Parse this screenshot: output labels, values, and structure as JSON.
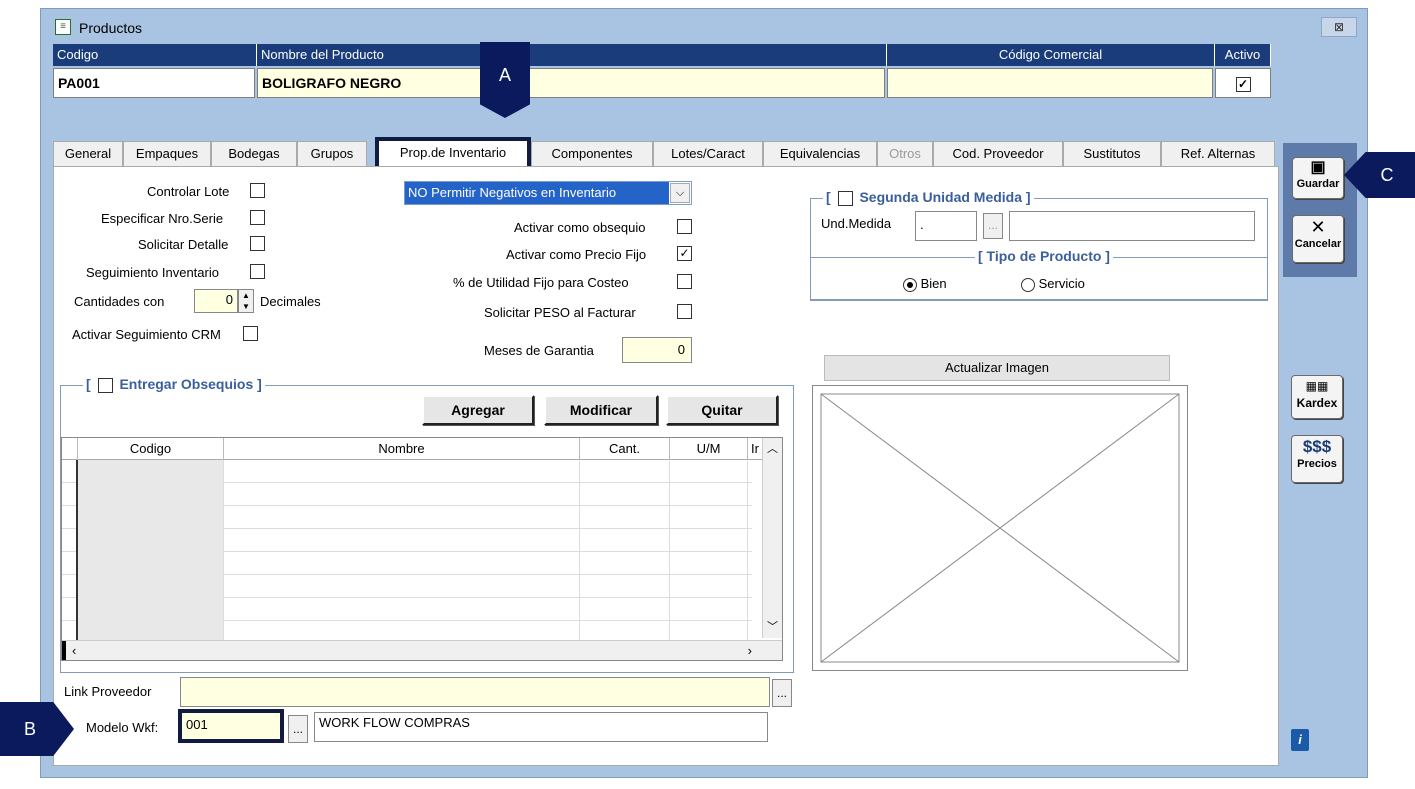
{
  "window": {
    "title": "Productos",
    "close": "⊠"
  },
  "header": {
    "cols": [
      "Codigo",
      "Nombre del Producto",
      "Código Comercial",
      "Activo"
    ],
    "codigo": "PA001",
    "nombre": "BOLIGRAFO NEGRO",
    "codigo_comercial": "",
    "activo_checked": "✓"
  },
  "tabs": [
    "General",
    "Empaques",
    "Bodegas",
    "Grupos",
    "Prop.de Inventario",
    "Componentes",
    "Lotes/Caract",
    "Equivalencias",
    "Otros",
    "Cod. Proveedor",
    "Sustitutos",
    "Ref. Alternas"
  ],
  "left_options": {
    "controlar_lote": "Controlar Lote",
    "especificar_serie": "Especificar Nro.Serie",
    "solicitar_detalle": "Solicitar Detalle",
    "seguimiento_inventario": "Seguimiento Inventario",
    "cantidades_con": "Cantidades con",
    "decimales_value": "0",
    "decimales": "Decimales",
    "seguimiento_crm": "Activar Seguimiento CRM"
  },
  "mid_options": {
    "negativos_select": "NO Permitir  Negativos en Inventario",
    "obsequio": "Activar como obsequio",
    "precio_fijo": "Activar como Precio Fijo",
    "precio_fijo_checked": "✓",
    "utilidad_fijo": "% de Utilidad Fijo para Costeo",
    "solicitar_peso": "Solicitar  PESO  al  Facturar",
    "meses_garantia": "Meses de Garantia",
    "meses_value": "0"
  },
  "segunda_unidad": {
    "title": "Segunda Unidad Medida ]",
    "prefix": "[",
    "und_medida": "Und.Medida",
    "und_value": ".",
    "dots": "..."
  },
  "tipo_producto": {
    "title": "[  Tipo de Producto ]",
    "bien": "Bien",
    "servicio": "Servicio"
  },
  "imagen": {
    "actualizar": "Actualizar Imagen"
  },
  "obsequios": {
    "prefix": "[",
    "title": "Entregar Obsequios ]",
    "buttons": {
      "agregar": "Agregar",
      "modificar": "Modificar",
      "quitar": "Quitar"
    },
    "columns": [
      "Codigo",
      "Nombre",
      "Cant.",
      "U/M",
      "Ir"
    ]
  },
  "bottom": {
    "link_proveedor": "Link Proveedor",
    "link_value": "",
    "modelo_wkf": "Modelo Wkf:",
    "modelo_value": "001",
    "modelo_desc": "WORK FLOW COMPRAS",
    "dots": "..."
  },
  "sidebar": {
    "guardar": "Guardar",
    "cancelar": "Cancelar",
    "kardex": "Kardex",
    "precios_sym": "$$$",
    "precios": "Precios",
    "info": "i"
  },
  "callouts": {
    "a": "A",
    "b": "B",
    "c": "C"
  },
  "colors": {
    "header": "#1a3c7a",
    "callout": "#0a1a5c",
    "frame": "#a9c3e3",
    "input_yellow": "#ffffe1"
  }
}
